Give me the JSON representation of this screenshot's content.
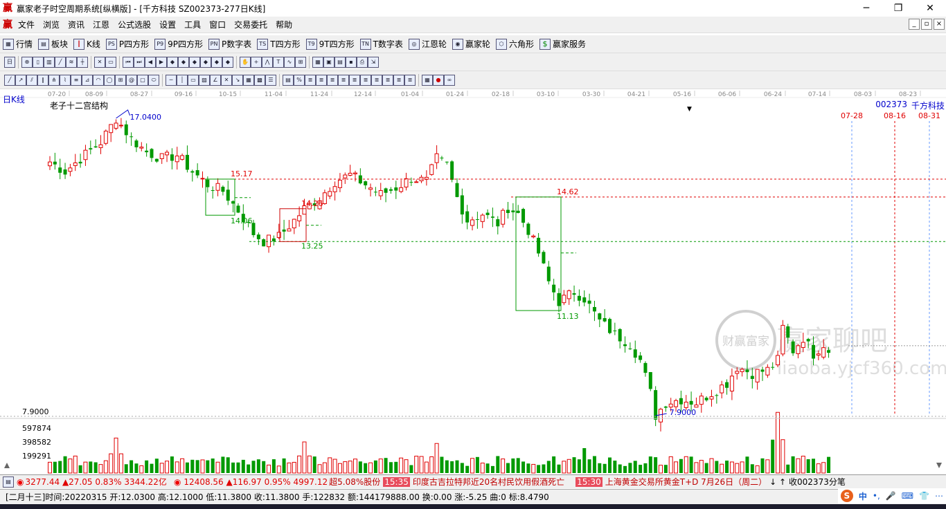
{
  "window": {
    "title": "赢家老子时空周期系统[纵横版] - [千方科技  SZ002373-277日K线]",
    "logo": "赢",
    "controls": {
      "minimize": "─",
      "maximize": "❐",
      "close": "✕"
    }
  },
  "menu": {
    "logo": "赢",
    "items": [
      "文件",
      "浏览",
      "资讯",
      "江恩",
      "公式选股",
      "设置",
      "工具",
      "窗口",
      "交易委托",
      "帮助"
    ],
    "mdi": {
      "minimize": "_",
      "restore": "▫",
      "close": "×"
    }
  },
  "toolbar1": {
    "items": [
      {
        "label": "行情",
        "icon": "table-icon"
      },
      {
        "label": "板块",
        "icon": "grid-icon"
      },
      {
        "label": "K线",
        "icon": "candles-icon"
      },
      {
        "label": "P四方形",
        "icon": "ps-icon",
        "glyph": "PS"
      },
      {
        "label": "9P四方形",
        "icon": "9p-icon",
        "glyph": "P9"
      },
      {
        "label": "P数字表",
        "icon": "pn-icon",
        "glyph": "PN"
      },
      {
        "label": "T四方形",
        "icon": "ts-icon",
        "glyph": "TS"
      },
      {
        "label": "9T四方形",
        "icon": "t9-icon",
        "glyph": "T9"
      },
      {
        "label": "T数字表",
        "icon": "tn-icon",
        "glyph": "TN"
      },
      {
        "label": "江恩轮",
        "icon": "wheel-icon",
        "glyph": "◎"
      },
      {
        "label": "赢家轮",
        "icon": "winner-wheel-icon",
        "glyph": "◉"
      },
      {
        "label": "六角形",
        "icon": "hexagon-icon",
        "glyph": "⬡"
      },
      {
        "label": "赢家服务",
        "icon": "dollar-icon",
        "glyph": "$"
      }
    ]
  },
  "chart": {
    "period_label": "日K线",
    "indicator_name": "老子十二宫结构",
    "stock_code": "002373",
    "stock_name": "千方科技",
    "dropdown_arrow": "▼",
    "dates_axis": [
      "07-20",
      "08-09",
      "08-27",
      "09-16",
      "10-15",
      "11-04",
      "11-24",
      "12-14",
      "01-04",
      "01-24",
      "02-18",
      "03-10",
      "03-30",
      "04-21",
      "05-16",
      "06-06",
      "06-24",
      "07-14",
      "08-03",
      "08-23"
    ],
    "future_dates": [
      "07-28",
      "08-16",
      "08-31"
    ],
    "annotations": {
      "high": "17.0400",
      "low": "7.9000",
      "level_1517": "15.17",
      "level_1406": "14.06",
      "level_1426": "14.26",
      "level_1325": "13.25",
      "level_1462": "14.62",
      "level_1113": "11.13"
    },
    "axis_low_label": "7.9000",
    "volume_labels": [
      "597874",
      "398582",
      "199291"
    ],
    "watermark_text": "赢家聊吧",
    "watermark_url": "liaoba.yjcf360.com",
    "watermark_seal": "财赢富家",
    "colors": {
      "up": "#e00000",
      "down": "#009900",
      "level": "#e00000",
      "support": "#009900",
      "box": "#009900",
      "future": "#0066cc"
    }
  },
  "chart_data": {
    "type": "candlestick",
    "x_ticks": [
      "07-20",
      "08-09",
      "08-27",
      "09-16",
      "10-15",
      "11-04",
      "11-24",
      "12-14",
      "01-04",
      "01-24",
      "02-18",
      "03-10",
      "03-30",
      "04-21",
      "05-16",
      "06-06",
      "06-24",
      "07-14",
      "08-03",
      "08-23"
    ],
    "price_path": [
      [
        0,
        15.7
      ],
      [
        3,
        15.4
      ],
      [
        6,
        15.8
      ],
      [
        10,
        16.3
      ],
      [
        13,
        17.04
      ],
      [
        16,
        16.4
      ],
      [
        19,
        16.0
      ],
      [
        22,
        15.8
      ],
      [
        25,
        15.9
      ],
      [
        28,
        15.4
      ],
      [
        31,
        15.0
      ],
      [
        34,
        14.8
      ],
      [
        37,
        14.2
      ],
      [
        40,
        13.5
      ],
      [
        42,
        13.25
      ],
      [
        45,
        13.4
      ],
      [
        48,
        13.9
      ],
      [
        50,
        14.26
      ],
      [
        53,
        14.6
      ],
      [
        56,
        15.1
      ],
      [
        59,
        15.3
      ],
      [
        62,
        15.0
      ],
      [
        65,
        14.7
      ],
      [
        68,
        14.9
      ],
      [
        71,
        15.2
      ],
      [
        74,
        15.1
      ],
      [
        76,
        15.8
      ],
      [
        78,
        15.6
      ],
      [
        80,
        14.6
      ],
      [
        82,
        13.9
      ],
      [
        85,
        14.1
      ],
      [
        88,
        13.8
      ],
      [
        90,
        14.3
      ],
      [
        92,
        14.1
      ],
      [
        94,
        13.6
      ],
      [
        96,
        12.9
      ],
      [
        98,
        12.0
      ],
      [
        100,
        11.4
      ],
      [
        103,
        11.7
      ],
      [
        105,
        11.5
      ],
      [
        108,
        10.8
      ],
      [
        111,
        10.4
      ],
      [
        114,
        10.1
      ],
      [
        116,
        9.6
      ],
      [
        118,
        8.6
      ],
      [
        119,
        7.9
      ],
      [
        121,
        8.3
      ],
      [
        124,
        8.4
      ],
      [
        127,
        8.3
      ],
      [
        130,
        8.6
      ],
      [
        133,
        8.9
      ],
      [
        135,
        9.4
      ],
      [
        138,
        9.2
      ],
      [
        141,
        9.3
      ],
      [
        143,
        9.6
      ],
      [
        144,
        10.6
      ],
      [
        146,
        9.9
      ],
      [
        148,
        10.3
      ],
      [
        150,
        9.8
      ],
      [
        152,
        10.1
      ],
      [
        153,
        9.9
      ]
    ],
    "price_range": [
      7.9,
      17.04
    ],
    "levels": [
      {
        "label": "15.17",
        "value": 15.17
      },
      {
        "label": "14.62",
        "value": 14.62
      },
      {
        "label": "13.25",
        "value": 13.25
      }
    ],
    "high": 17.04,
    "low": 7.9,
    "volume_ticks": [
      199291,
      398582,
      597874
    ],
    "volume_spikes": [
      [
        13,
        450000
      ],
      [
        50,
        400000
      ],
      [
        76,
        380000
      ],
      [
        105,
        320000
      ],
      [
        143,
        780000
      ]
    ]
  },
  "status1": {
    "sh_index": "3277.44",
    "sh_change": "▲27.05",
    "sh_pct": "0.83%",
    "sh_amount": "3344.22亿",
    "sz_index": "12408.56",
    "sz_change": "▲116.97",
    "sz_pct": "0.95%",
    "sz_amount": "4997.12",
    "news_prefix": "超5.08%股份",
    "news1_time": "15:35",
    "news1_text": "印度古吉拉特邦近20名村民饮用假酒死亡",
    "news2_time": "15:30",
    "news2_text": "上海黄金交易所黄金T+D 7月26日（周二）",
    "arrows": "↓ ↑",
    "right_text": "收002373分笔"
  },
  "status2": {
    "lunar": "[二月十三]",
    "time_label": "时间:",
    "time": "20220315",
    "open_label": "开:",
    "open": "12.0300",
    "high_label": "高:",
    "high": "12.1000",
    "low_label": "低:",
    "low": "11.3800",
    "close_label": "收:",
    "close": "11.3800",
    "hands_label": "手:",
    "hands": "122832",
    "amount_label": "额:",
    "amount": "144179888.00",
    "turnover_label": "换:",
    "turnover": "0.00",
    "change_label": "涨:",
    "change": "-5.25",
    "line_label": "曲:",
    "line": "0",
    "mark_label": "标:",
    "mark": "8.4790"
  },
  "ime": {
    "logo": "S",
    "mode": "中",
    "punct": "•,",
    "voice": "🎤",
    "keyboard": "⌨",
    "skin": "👕",
    "more": "⋯"
  }
}
